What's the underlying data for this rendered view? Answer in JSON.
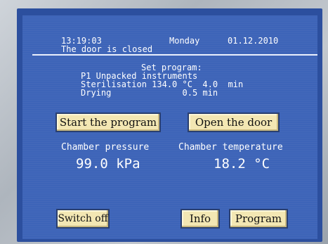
{
  "header": {
    "time": "13:19:03",
    "day": "Monday",
    "date": "01.12.2010",
    "door_status": "The door is closed"
  },
  "program_info": {
    "title": "Set program:",
    "program_name": "P1 Unpacked instruments",
    "sterilisation": "Sterilisation 134.0 °C  4.0  min",
    "drying": "Drying              0.5 min"
  },
  "buttons": {
    "start": "Start the program",
    "open_door": "Open the door",
    "switch_off": "Switch off",
    "info": "Info",
    "program": "Program"
  },
  "readings": {
    "pressure_label": "Chamber pressure",
    "pressure_value": "99.0 kPa",
    "temperature_label": "Chamber temperature",
    "temperature_value": "18.2 °C"
  },
  "colors": {
    "screen": "#3d64b8",
    "bezel": "#2c4f9e",
    "button": "#f3e7b3",
    "text": "#ffffff"
  }
}
